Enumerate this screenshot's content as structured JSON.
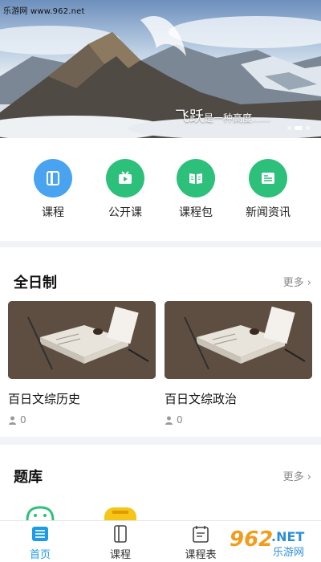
{
  "watermark_top": "乐游网 www.962.net",
  "banner": {
    "caption_main": "飞跃",
    "caption_rest": "是一种高度......",
    "dots": 3,
    "active_dot": 1
  },
  "quick_entries": [
    {
      "label": "课程",
      "icon": "book-icon",
      "color": "#4aa3f0"
    },
    {
      "label": "公开课",
      "icon": "video-icon",
      "color": "#2cc07a"
    },
    {
      "label": "课程包",
      "icon": "open-book-icon",
      "color": "#2cc07a"
    },
    {
      "label": "新闻资讯",
      "icon": "news-icon",
      "color": "#2cc07a"
    }
  ],
  "full_time": {
    "title": "全日制",
    "more": "更多 ›",
    "courses": [
      {
        "title": "百日文综历史",
        "count": "0"
      },
      {
        "title": "百日文综政治",
        "count": "0"
      }
    ]
  },
  "question_bank": {
    "title": "题库",
    "more": "更多 ›"
  },
  "tabbar": {
    "items": [
      {
        "label": "首页",
        "icon": "home-list-icon",
        "active": true
      },
      {
        "label": "课程",
        "icon": "book-icon",
        "active": false
      },
      {
        "label": "课程表",
        "icon": "schedule-icon",
        "active": false
      }
    ]
  },
  "watermark_logo": {
    "number": "962",
    "suffix": ".NET",
    "cn": "乐游网"
  },
  "colors": {
    "accent": "#1e9be6",
    "green": "#2cc07a",
    "blue": "#4aa3f0"
  }
}
